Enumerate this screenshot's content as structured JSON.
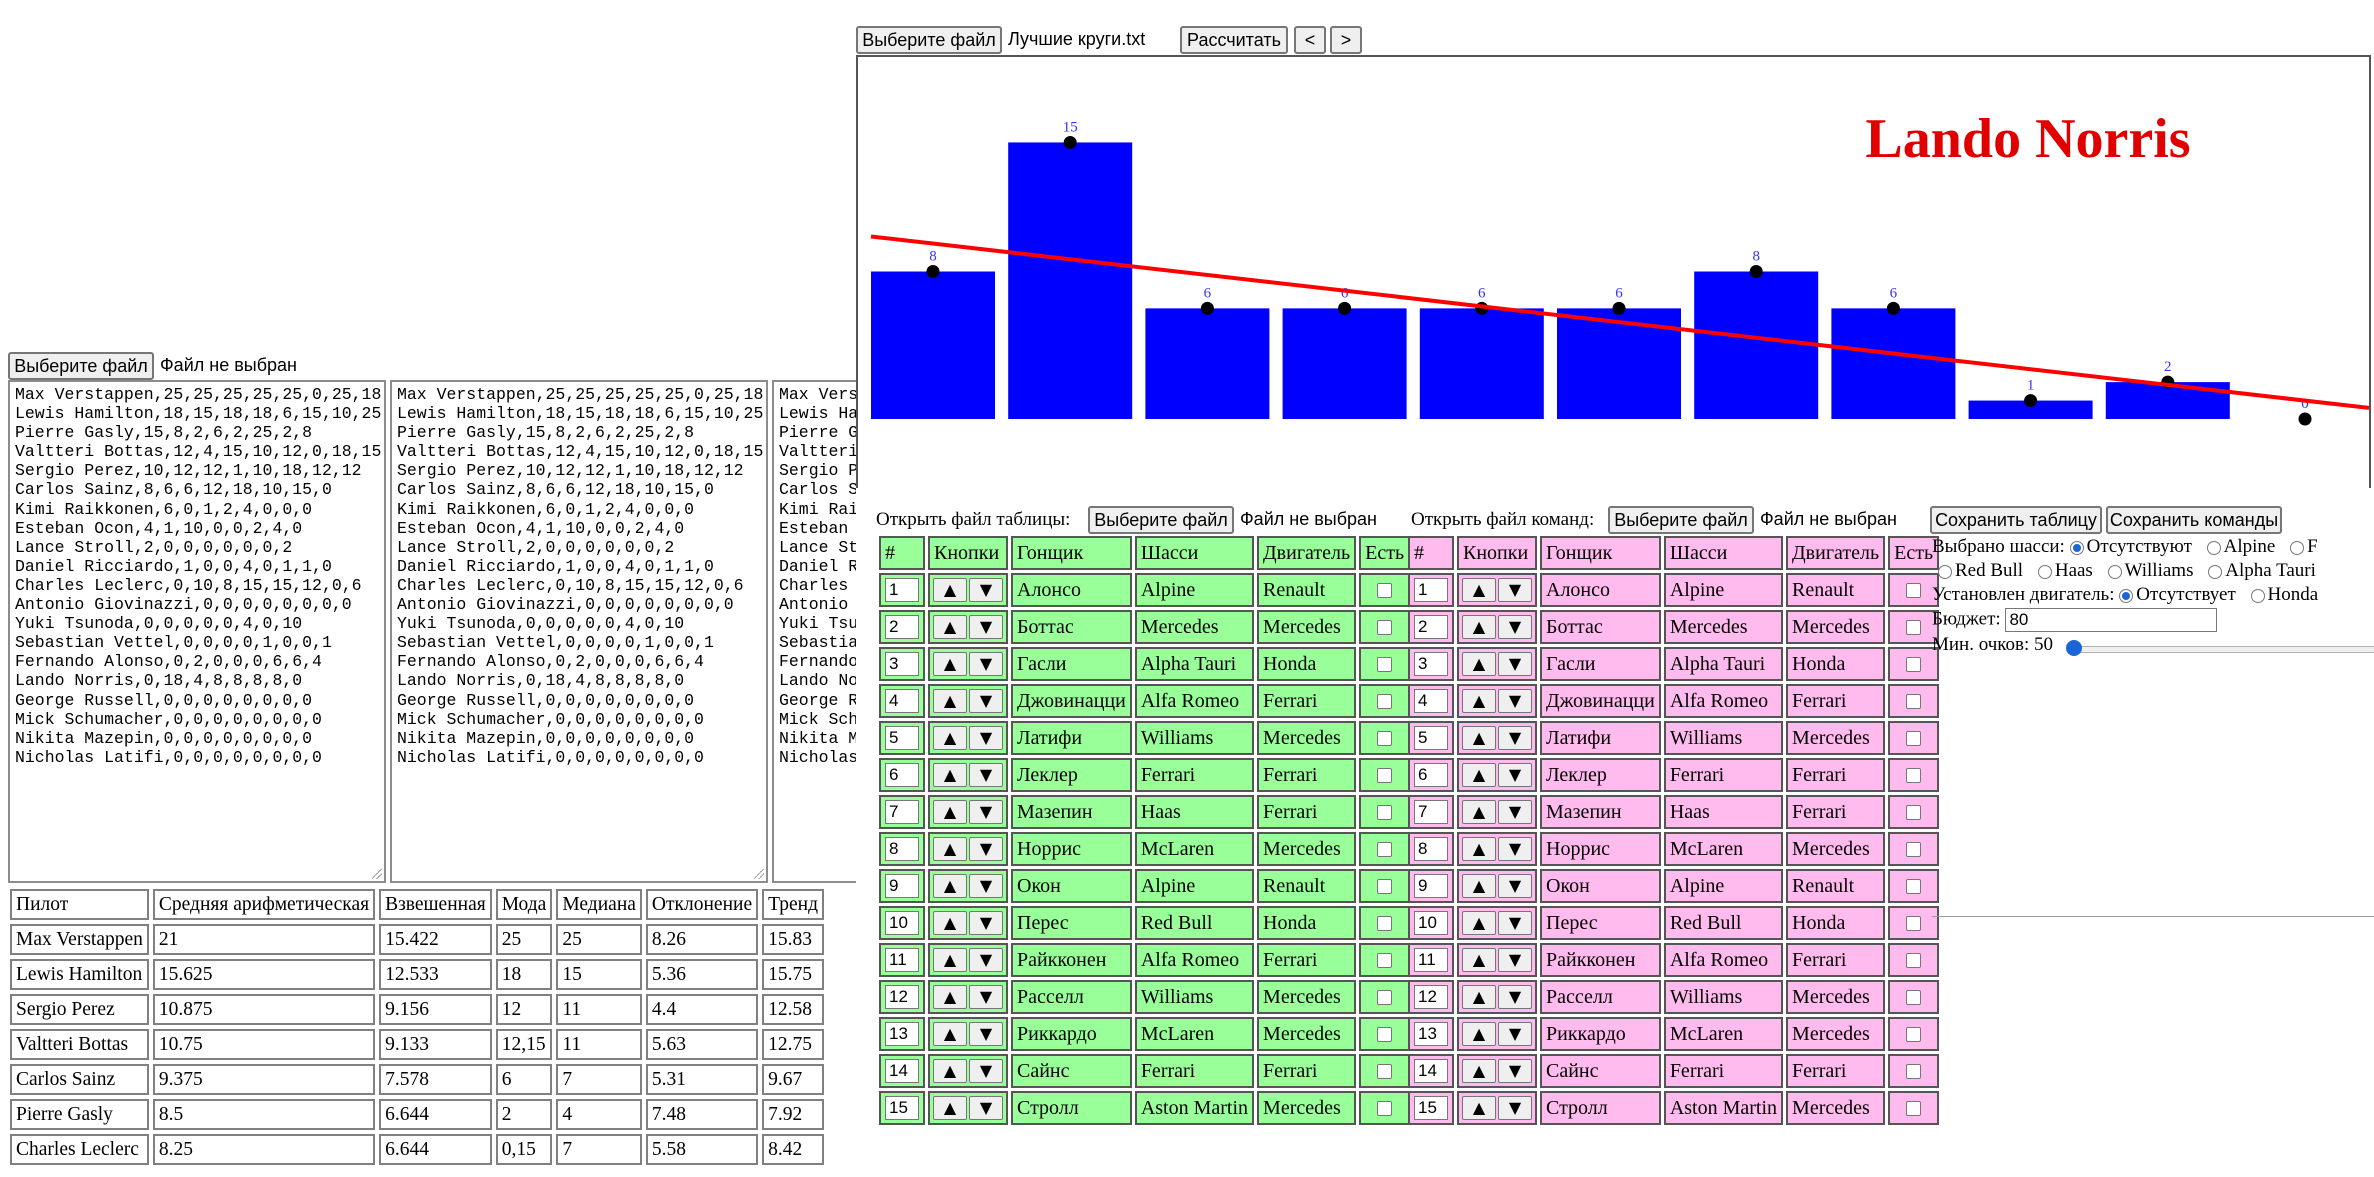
{
  "chart_panel": {
    "file_button": "Выберите файл",
    "file_name": "Лучшие круги.txt",
    "calc_button": "Рассчитать",
    "prev_button": "<",
    "next_button": ">"
  },
  "chart_data": {
    "type": "bar",
    "title": "Lando Norris",
    "title_color": "#e00000",
    "bar_color": "#0000ff",
    "trend_color": "#ff0000",
    "values": [
      8,
      15,
      6,
      6,
      6,
      6,
      8,
      6,
      1,
      2,
      0
    ],
    "labels": [
      "8",
      "15",
      "6",
      "6",
      "6",
      "6",
      "8",
      "6",
      "1",
      "2",
      "0"
    ],
    "trend": {
      "start": 9.9,
      "end": 0.6
    },
    "ylim": [
      0,
      16
    ]
  },
  "left_panel": {
    "file_button": "Выберите файл",
    "file_status": "Файл не выбран",
    "textarea_lines": [
      "Max Verstappen,25,25,25,25,25,0,25,18",
      "Lewis Hamilton,18,15,18,18,6,15,10,25",
      "Pierre Gasly,15,8,2,6,2,25,2,8",
      "Valtteri Bottas,12,4,15,10,12,0,18,15",
      "Sergio Perez,10,12,12,1,10,18,12,12",
      "Carlos Sainz,8,6,6,12,18,10,15,0",
      "Kimi Raikkonen,6,0,1,2,4,0,0,0",
      "Esteban Ocon,4,1,10,0,0,2,4,0",
      "Lance Stroll,2,0,0,0,0,0,0,2",
      "Daniel Ricciardo,1,0,0,4,0,1,1,0",
      "Charles Leclerc,0,10,8,15,15,12,0,6",
      "Antonio Giovinazzi,0,0,0,0,0,0,0,0",
      "Yuki Tsunoda,0,0,0,0,0,4,0,10",
      "Sebastian Vettel,0,0,0,0,1,0,0,1",
      "Fernando Alonso,0,2,0,0,0,6,6,4",
      "Lando Norris,0,18,4,8,8,8,8,0",
      "George Russell,0,0,0,0,0,0,0,0",
      "Mick Schumacher,0,0,0,0,0,0,0,0",
      "Nikita Mazepin,0,0,0,0,0,0,0,0",
      "Nicholas Latifi,0,0,0,0,0,0,0,0"
    ],
    "textarea3_lines": [
      "Max Verst",
      "Lewis Ham",
      "Pierre Ga",
      "Valtteri",
      "Sergio Pe",
      "Carlos Sa",
      "Kimi Raik",
      "Esteban O",
      "Lance Str",
      "Daniel Ri",
      "Charles L",
      "Antonio G",
      "Yuki Tsun",
      "Sebastian",
      "Fernando",
      "Lando Nor",
      "George Ru",
      "Mick Schu",
      "Nikita Ma",
      "Nicholas"
    ]
  },
  "stats_table": {
    "headers": [
      "Пилот",
      "Средняя арифметическая",
      "Взвешенная",
      "Мода",
      "Медиана",
      "Отклонение",
      "Тренд"
    ],
    "rows": [
      [
        "Max Verstappen",
        "21",
        "15.422",
        "25",
        "25",
        "8.26",
        "15.83"
      ],
      [
        "Lewis Hamilton",
        "15.625",
        "12.533",
        "18",
        "15",
        "5.36",
        "15.75"
      ],
      [
        "Sergio Perez",
        "10.875",
        "9.156",
        "12",
        "11",
        "4.4",
        "12.58"
      ],
      [
        "Valtteri Bottas",
        "10.75",
        "9.133",
        "12,15",
        "11",
        "5.63",
        "12.75"
      ],
      [
        "Carlos Sainz",
        "9.375",
        "7.578",
        "6",
        "7",
        "5.31",
        "9.67"
      ],
      [
        "Pierre Gasly",
        "8.5",
        "6.644",
        "2",
        "4",
        "7.48",
        "7.92"
      ],
      [
        "Charles Leclerc",
        "8.25",
        "6.644",
        "0,15",
        "7",
        "5.58",
        "8.42"
      ]
    ]
  },
  "table_tools": {
    "open_table_label": "Открыть файл таблицы:",
    "open_teams_label": "Открыть файл команд:",
    "file_button": "Выберите файл",
    "file_status": "Файл не выбран",
    "save_table": "Сохранить таблицу",
    "save_teams": "Сохранить команды"
  },
  "driver_tables": {
    "headers": [
      "#",
      "Кнопки",
      "Гонщик",
      "Шасси",
      "Двигатель",
      "Есть"
    ],
    "up_arrow": "▲",
    "down_arrow": "▼",
    "rows": [
      [
        "1",
        "Алонсо",
        "Alpine",
        "Renault"
      ],
      [
        "2",
        "Боттас",
        "Mercedes",
        "Mercedes"
      ],
      [
        "3",
        "Гасли",
        "Alpha Tauri",
        "Honda"
      ],
      [
        "4",
        "Джовинацци",
        "Alfa Romeo",
        "Ferrari"
      ],
      [
        "5",
        "Латифи",
        "Williams",
        "Mercedes"
      ],
      [
        "6",
        "Леклер",
        "Ferrari",
        "Ferrari"
      ],
      [
        "7",
        "Мазепин",
        "Haas",
        "Ferrari"
      ],
      [
        "8",
        "Норрис",
        "McLaren",
        "Mercedes"
      ],
      [
        "9",
        "Окон",
        "Alpine",
        "Renault"
      ],
      [
        "10",
        "Перес",
        "Red Bull",
        "Honda"
      ],
      [
        "11",
        "Райкконен",
        "Alfa Romeo",
        "Ferrari"
      ],
      [
        "12",
        "Расселл",
        "Williams",
        "Mercedes"
      ],
      [
        "13",
        "Риккардо",
        "McLaren",
        "Mercedes"
      ],
      [
        "14",
        "Сайнс",
        "Ferrari",
        "Ferrari"
      ],
      [
        "15",
        "Стролл",
        "Aston Martin",
        "Mercedes"
      ]
    ]
  },
  "filters": {
    "chassis_label": "Выбрано шасси:",
    "chassis_options_row1": [
      "Отсутствуют",
      "Alpine",
      "F"
    ],
    "chassis_options_row2": [
      "Red Bull",
      "Haas",
      "Williams",
      "Alpha Tauri"
    ],
    "engine_label": "Установлен двигатель:",
    "engine_options": [
      "Отсутствует",
      "Honda"
    ],
    "budget_label": "Бюджет:",
    "budget_value": "80",
    "min_points_label": "Мин. очков: 50",
    "min_points_value": 50
  }
}
